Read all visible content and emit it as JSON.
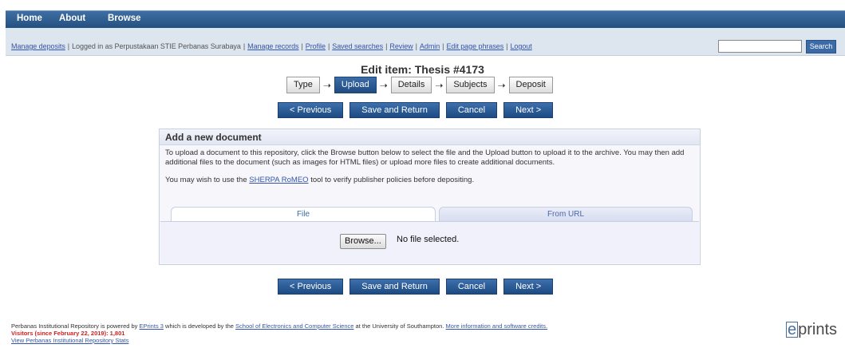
{
  "nav": {
    "items": [
      "Home",
      "About",
      "Browse"
    ]
  },
  "toolbar": {
    "manage_deposits": "Manage deposits",
    "logged_in": "Logged in as Perpustakaan STIE Perbanas Surabaya",
    "links": [
      "Manage records",
      "Profile",
      "Saved searches",
      "Review",
      "Admin",
      "Edit page phrases",
      "Logout"
    ],
    "search_value": "",
    "search_label": "Search"
  },
  "page": {
    "title": "Edit item: Thesis #4173"
  },
  "workflow": {
    "steps": [
      "Type",
      "Upload",
      "Details",
      "Subjects",
      "Deposit"
    ],
    "active": "Upload"
  },
  "buttons": {
    "previous": "< Previous",
    "save_return": "Save and Return",
    "cancel": "Cancel",
    "next": "Next >"
  },
  "panel": {
    "title": "Add a new document",
    "intro": "To upload a document to this repository, click the Browse button below to select the file and the Upload button to upload it to the archive. You may then add additional files to the document (such as images for HTML files) or upload more files to create additional documents.",
    "sherpa_prefix": "You may wish to use the",
    "sherpa_link": "SHERPA RoMEO",
    "sherpa_suffix": "tool to verify publisher policies before depositing.",
    "tabs": [
      "File",
      "From URL"
    ],
    "browse_label": "Browse...",
    "no_file": "No file selected."
  },
  "footer": {
    "line1_prefix": "Perbanas Institutional Repository is powered by",
    "eprints_link": "EPrints 3",
    "line1_mid": "which is developed by the",
    "school_link": "School of Electronics and Computer Science",
    "line1_suffix": "at the University of Southampton.",
    "credits_link": "More information and software credits.",
    "visitors": "Visitors (since February 22, 2019): 1,801",
    "stats_link": "View Perbanas Institutional Repository Stats"
  },
  "logo": {
    "e": "e",
    "rest": "prints"
  }
}
